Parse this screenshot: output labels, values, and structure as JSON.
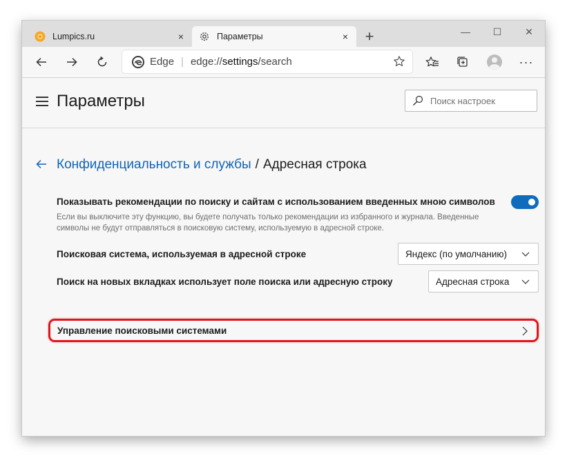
{
  "tabs": [
    {
      "label": "Lumpics.ru",
      "close": "×",
      "active": false
    },
    {
      "label": "Параметры",
      "close": "×",
      "active": true
    }
  ],
  "new_tab_symbol": "+",
  "window_controls": {
    "minimize": "—",
    "maximize": "☐",
    "close": "✕"
  },
  "address_bar": {
    "site_name": "Edge",
    "separator": "|",
    "url_prefix": "edge://",
    "url_main": "settings",
    "url_suffix": "/search"
  },
  "header": {
    "title": "Параметры",
    "search_placeholder": "Поиск настроек"
  },
  "breadcrumb": {
    "parent": "Конфиденциальность и службы",
    "separator": "/",
    "current": "Адресная строка"
  },
  "settings": {
    "suggestions": {
      "title": "Показывать рекомендации по поиску и сайтам с использованием введенных мною символов",
      "desc_line1": "Если вы выключите эту функцию, вы будете получать только рекомендации из избранного и журнала. Введенные",
      "desc_line2": "символы не будут отправляться в поисковую систему, используемую в адресной строке.",
      "enabled": true
    },
    "search_engine": {
      "title": "Поисковая система, используемая в адресной строке",
      "value": "Яндекс (по умолчанию)"
    },
    "new_tab_search": {
      "title": "Поиск на новых вкладках использует поле поиска или адресную строку",
      "value": "Адресная строка"
    },
    "manage_engines": {
      "title": "Управление поисковыми системами"
    }
  },
  "colors": {
    "accent": "#0f6cbd",
    "link": "#0c64b8",
    "highlight": "#e0151b",
    "favicon_lumpics": "#f5a623"
  },
  "icons": [
    "lumpics-favicon",
    "gear-icon",
    "back-arrow-icon",
    "forward-arrow-icon",
    "refresh-icon",
    "edge-logo-icon",
    "star-icon",
    "favorites-icon",
    "collections-icon",
    "profile-icon",
    "more-icon",
    "hamburger-icon",
    "search-icon",
    "chevron-down-icon",
    "chevron-right-icon"
  ]
}
